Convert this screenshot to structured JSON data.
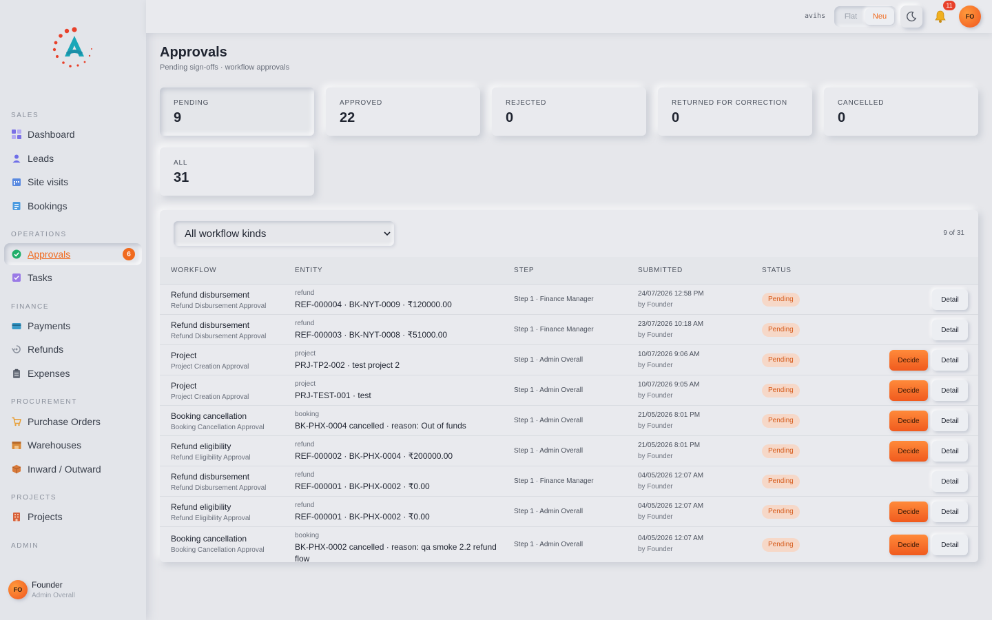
{
  "topbar": {
    "username": "avihs",
    "theme_toggle": {
      "option_flat": "Flat",
      "option_neu": "Neu",
      "selected": "Neu"
    },
    "notifications_count": "11",
    "avatar_initials": "FO"
  },
  "sidebar": {
    "sections": [
      {
        "label": "SALES"
      },
      {
        "label": "OPERATIONS"
      },
      {
        "label": "FINANCE"
      },
      {
        "label": "PROCUREMENT"
      },
      {
        "label": "PROJECTS"
      },
      {
        "label": "ADMIN"
      }
    ],
    "items": [
      {
        "label": "Dashboard",
        "icon": "grid-icon"
      },
      {
        "label": "Leads",
        "icon": "user-icon"
      },
      {
        "label": "Site visits",
        "icon": "calendar-icon"
      },
      {
        "label": "Bookings",
        "icon": "document-icon"
      },
      {
        "label": "Approvals",
        "icon": "check-circle-icon",
        "badge": "6",
        "active": true
      },
      {
        "label": "Tasks",
        "icon": "checkbox-icon"
      },
      {
        "label": "Payments",
        "icon": "card-icon"
      },
      {
        "label": "Refunds",
        "icon": "refund-icon"
      },
      {
        "label": "Expenses",
        "icon": "clipboard-icon"
      },
      {
        "label": "Purchase Orders",
        "icon": "cart-icon"
      },
      {
        "label": "Warehouses",
        "icon": "warehouse-icon"
      },
      {
        "label": "Inward / Outward",
        "icon": "box-icon"
      },
      {
        "label": "Projects",
        "icon": "building-icon"
      }
    ],
    "user": {
      "initials": "FO",
      "name": "Founder",
      "role": "Admin Overall"
    }
  },
  "page": {
    "title": "Approvals",
    "subtitle": "Pending sign-offs · workflow approvals"
  },
  "stats": [
    {
      "label": "PENDING",
      "value": "9",
      "active": true
    },
    {
      "label": "APPROVED",
      "value": "22"
    },
    {
      "label": "REJECTED",
      "value": "0"
    },
    {
      "label": "RETURNED FOR CORRECTION",
      "value": "0"
    },
    {
      "label": "CANCELLED",
      "value": "0"
    },
    {
      "label": "ALL",
      "value": "31"
    }
  ],
  "filter": {
    "selected": "All workflow kinds",
    "count": "9 of 31"
  },
  "table": {
    "headers": [
      "WORKFLOW",
      "ENTITY",
      "STEP",
      "SUBMITTED",
      "STATUS"
    ],
    "decide_label": "Decide",
    "detail_label": "Detail",
    "rows": [
      {
        "workflow": "Refund disbursement",
        "workflow_sub": "Refund Disbursement Approval",
        "entity_kind": "refund",
        "entity": "REF-000004 · BK-NYT-0009 · ₹120000.00",
        "step": "Step 1 · Finance Manager",
        "submitted": "24/07/2026 12:58 PM",
        "by": "by Founder",
        "status": "Pending",
        "can_decide": false
      },
      {
        "workflow": "Refund disbursement",
        "workflow_sub": "Refund Disbursement Approval",
        "entity_kind": "refund",
        "entity": "REF-000003 · BK-NYT-0008 · ₹51000.00",
        "step": "Step 1 · Finance Manager",
        "submitted": "23/07/2026 10:18 AM",
        "by": "by Founder",
        "status": "Pending",
        "can_decide": false
      },
      {
        "workflow": "Project",
        "workflow_sub": "Project Creation Approval",
        "entity_kind": "project",
        "entity": "PRJ-TP2-002 · test project 2",
        "step": "Step 1 · Admin Overall",
        "submitted": "10/07/2026 9:06 AM",
        "by": "by Founder",
        "status": "Pending",
        "can_decide": true
      },
      {
        "workflow": "Project",
        "workflow_sub": "Project Creation Approval",
        "entity_kind": "project",
        "entity": "PRJ-TEST-001 · test",
        "step": "Step 1 · Admin Overall",
        "submitted": "10/07/2026 9:05 AM",
        "by": "by Founder",
        "status": "Pending",
        "can_decide": true
      },
      {
        "workflow": "Booking cancellation",
        "workflow_sub": "Booking Cancellation Approval",
        "entity_kind": "booking",
        "entity": "BK-PHX-0004 cancelled · reason: Out of funds",
        "step": "Step 1 · Admin Overall",
        "submitted": "21/05/2026 8:01 PM",
        "by": "by Founder",
        "status": "Pending",
        "can_decide": true
      },
      {
        "workflow": "Refund eligibility",
        "workflow_sub": "Refund Eligibility Approval",
        "entity_kind": "refund",
        "entity": "REF-000002 · BK-PHX-0004 · ₹200000.00",
        "step": "Step 1 · Admin Overall",
        "submitted": "21/05/2026 8:01 PM",
        "by": "by Founder",
        "status": "Pending",
        "can_decide": true
      },
      {
        "workflow": "Refund disbursement",
        "workflow_sub": "Refund Disbursement Approval",
        "entity_kind": "refund",
        "entity": "REF-000001 · BK-PHX-0002 · ₹0.00",
        "step": "Step 1 · Finance Manager",
        "submitted": "04/05/2026 12:07 AM",
        "by": "by Founder",
        "status": "Pending",
        "can_decide": false
      },
      {
        "workflow": "Refund eligibility",
        "workflow_sub": "Refund Eligibility Approval",
        "entity_kind": "refund",
        "entity": "REF-000001 · BK-PHX-0002 · ₹0.00",
        "step": "Step 1 · Admin Overall",
        "submitted": "04/05/2026 12:07 AM",
        "by": "by Founder",
        "status": "Pending",
        "can_decide": true
      },
      {
        "workflow": "Booking cancellation",
        "workflow_sub": "Booking Cancellation Approval",
        "entity_kind": "booking",
        "entity": "BK-PHX-0002 cancelled · reason: qa smoke 2.2 refund flow",
        "step": "Step 1 · Admin Overall",
        "submitted": "04/05/2026 12:07 AM",
        "by": "by Founder",
        "status": "Pending",
        "can_decide": true
      }
    ]
  }
}
